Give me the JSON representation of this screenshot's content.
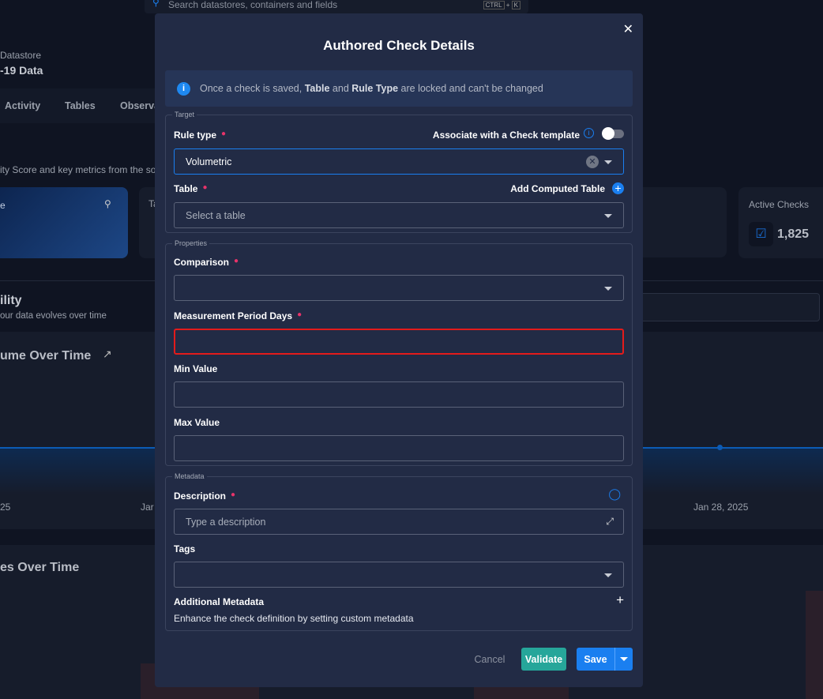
{
  "background": {
    "search_placeholder": "Search datastores, containers and fields",
    "shortcut": [
      "CTRL",
      "+",
      "K"
    ],
    "datastore_label": "Datastore",
    "datastore_name": "-19 Data",
    "tabs": [
      "Activity",
      "Tables",
      "Observa"
    ],
    "subtitle": "ity Score and key metrics from the so",
    "card_label": "e",
    "card2_label": "Ta",
    "active_checks_label": "Active Checks",
    "active_checks_value": "1,825",
    "section_title": "ility",
    "section_sub": "our data evolves over time",
    "chart1_title": "ume Over Time",
    "chart1_ticks": [
      "25",
      "Jar",
      "Jan 28, 2025"
    ],
    "chart2_title": "es Over Time"
  },
  "modal": {
    "title": "Authored Check Details",
    "info_pre": "Once a check is saved, ",
    "info_b1": "Table",
    "info_mid": " and ",
    "info_b2": "Rule Type",
    "info_post": " are locked and can't be changed",
    "target": {
      "legend": "Target",
      "rule_type_label": "Rule type",
      "template_label": "Associate with a Check template",
      "template_toggle_on": false,
      "rule_type_value": "Volumetric",
      "table_label": "Table",
      "add_computed": "Add Computed Table",
      "table_placeholder": "Select a table"
    },
    "properties": {
      "legend": "Properties",
      "comparison_label": "Comparison",
      "comparison_value": "",
      "period_label": "Measurement Period Days",
      "period_value": "",
      "min_label": "Min Value",
      "min_value": "",
      "max_label": "Max Value",
      "max_value": ""
    },
    "metadata": {
      "legend": "Metadata",
      "description_label": "Description",
      "description_placeholder": "Type a description",
      "tags_label": "Tags",
      "additional_title": "Additional Metadata",
      "additional_desc": "Enhance the check definition by setting custom metadata"
    },
    "buttons": {
      "cancel": "Cancel",
      "validate": "Validate",
      "save": "Save"
    }
  },
  "colors": {
    "accent": "#1a7ff0",
    "validate": "#26a69a",
    "error": "#e31b1b",
    "required": "#e8336a"
  }
}
